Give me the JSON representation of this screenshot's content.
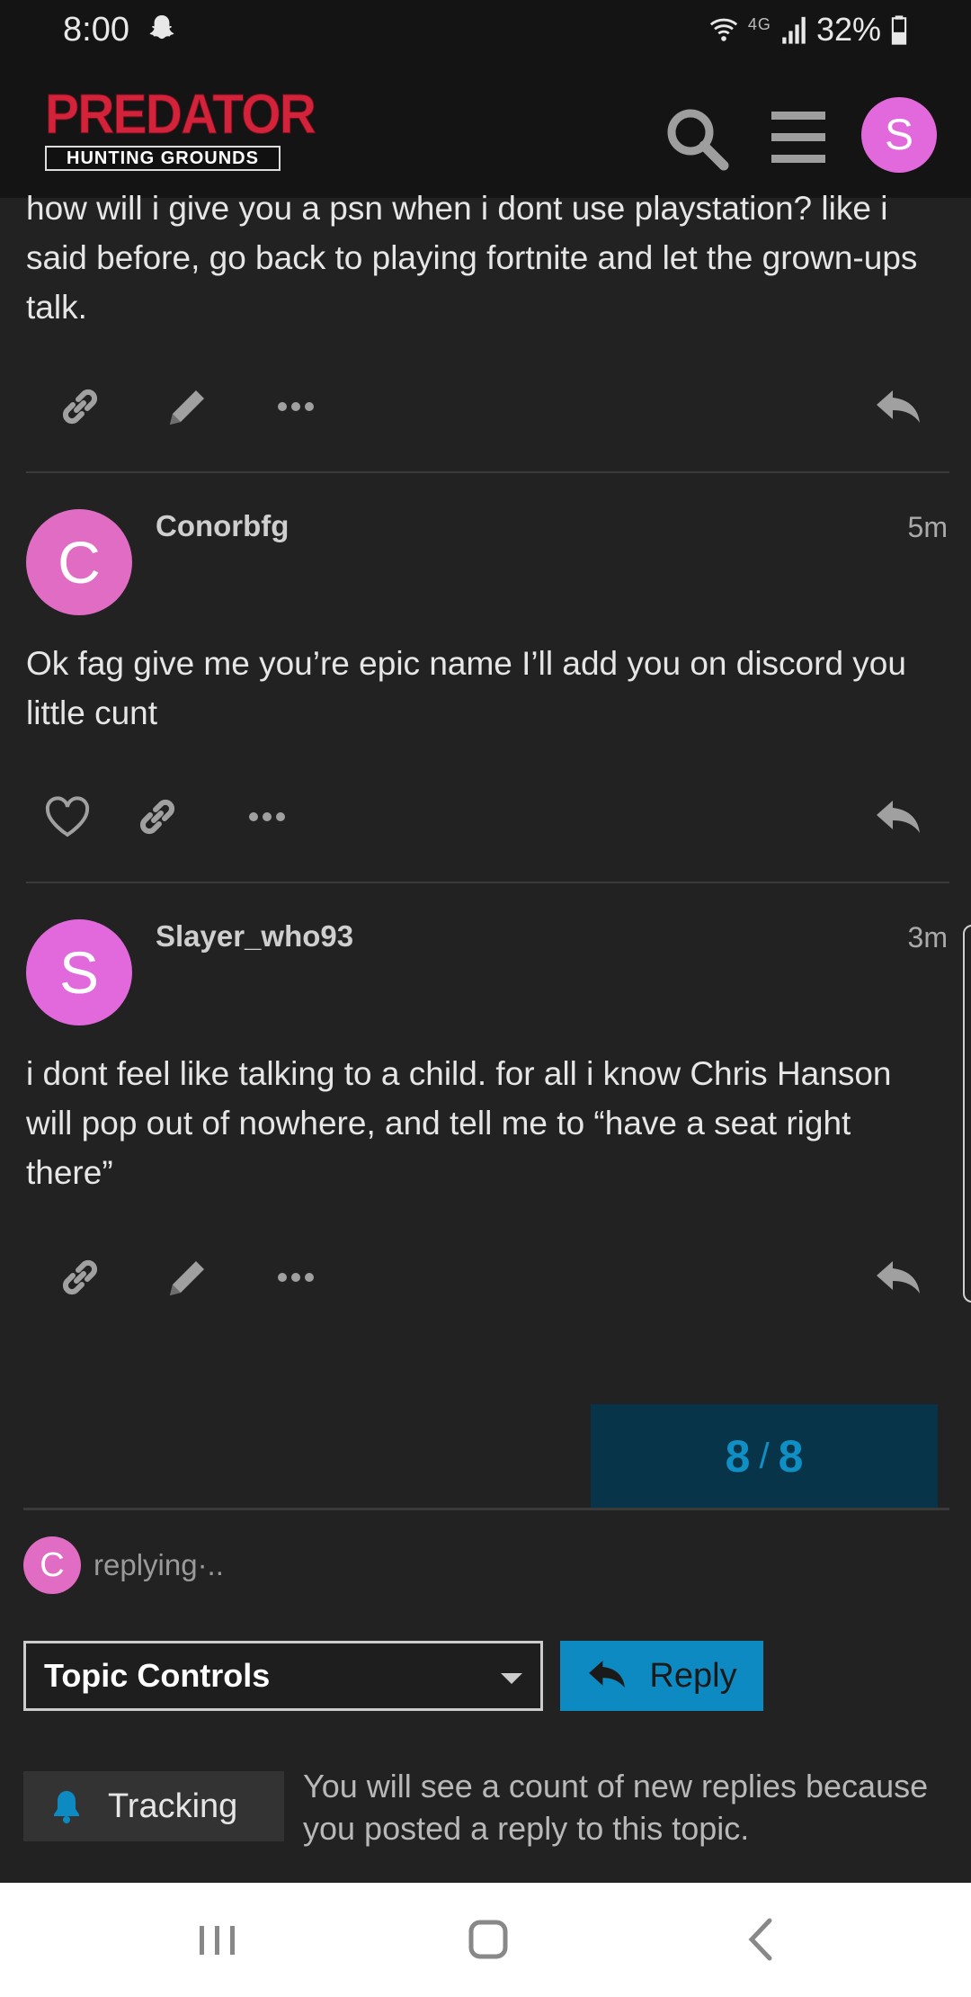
{
  "status_bar": {
    "time": "8:00",
    "network": "4G",
    "battery": "32%"
  },
  "header": {
    "logo_main": "PREDATOR",
    "logo_sub": "HUNTING GROUNDS",
    "user_initial": "S",
    "user_color": "#e269dc"
  },
  "posts": [
    {
      "partial": true,
      "text": "how will i give you a psn when i dont use playstation? like i said before, go back to playing fortnite and let the grown-ups talk.",
      "actions": [
        "link-icon",
        "pencil-icon",
        "more-icon",
        "reply-icon"
      ]
    },
    {
      "username": "Conorbfg",
      "initial": "C",
      "avatar_color": "#e06cc3",
      "time": "5m",
      "text": "Ok fag give me you’re epic name I’ll add you on discord you little cunt",
      "actions": [
        "heart-icon",
        "link-icon",
        "more-icon",
        "reply-icon"
      ]
    },
    {
      "username": "Slayer_who93",
      "initial": "S",
      "avatar_color": "#e269dc",
      "time": "3m",
      "text": "i dont feel like talking to a child. for all i know Chris Hanson will pop out of nowhere, and tell me to “have a seat right there”",
      "actions": [
        "link-icon",
        "pencil-icon",
        "more-icon",
        "reply-icon"
      ]
    }
  ],
  "progress": {
    "current": "8",
    "separator": "/",
    "total": "8"
  },
  "replying": {
    "initial": "C",
    "text": "replying·.."
  },
  "footer": {
    "topic_controls_label": "Topic Controls",
    "reply_label": "Reply",
    "tracking_label": "Tracking",
    "tracking_description": "You will see a count of new replies because you posted a reply to this topic."
  },
  "colors": {
    "accent": "#0d8ac2",
    "background": "#222222",
    "logo_red": "#d2233a"
  }
}
